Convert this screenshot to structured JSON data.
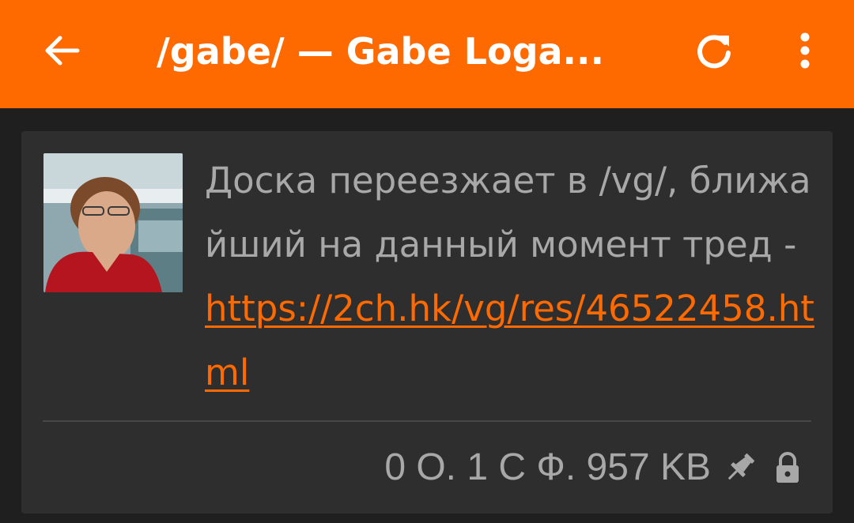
{
  "appbar": {
    "title": "/gabe/ — Gabe Loga...",
    "back_icon": "arrow-left-icon",
    "refresh_icon": "refresh-icon",
    "more_icon": "more-vert-icon",
    "color": "#ff6a00"
  },
  "thread": {
    "thumbnail_alt": "Gabe Logan",
    "comment_text": "Доска переезжает в /vg/, ближайший на данный момент тред - ",
    "link_text": "https://2ch.hk/vg/res/46522458.html",
    "stats": "0 О. 1 С Ф. 957 KB",
    "pin_icon": "pin-icon",
    "lock_icon": "lock-icon"
  }
}
